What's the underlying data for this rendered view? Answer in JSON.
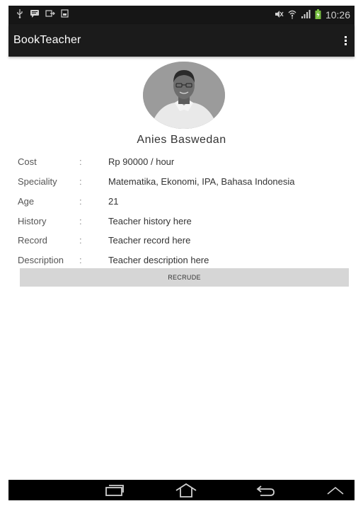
{
  "status_bar": {
    "time": "10:26",
    "icons_left": [
      "usb-icon",
      "message-icon",
      "transfer-icon",
      "gallery-icon"
    ],
    "icons_right": [
      "mute-icon",
      "wifi-icon",
      "signal-icon",
      "battery-icon"
    ]
  },
  "app_bar": {
    "title": "BookTeacher",
    "menu_icon": "overflow-menu-icon"
  },
  "teacher": {
    "name": "Anies Baswedan",
    "fields": [
      {
        "label": "Cost",
        "separator": ":",
        "value": "Rp 90000 / hour"
      },
      {
        "label": "Speciality",
        "separator": ":",
        "value": "Matematika, Ekonomi, IPA, Bahasa Indonesia"
      },
      {
        "label": "Age",
        "separator": ":",
        "value": "21"
      },
      {
        "label": "History",
        "separator": ":",
        "value": "Teacher history here"
      },
      {
        "label": "Record",
        "separator": ":",
        "value": "Teacher record here"
      },
      {
        "label": "Description",
        "separator": ":",
        "value": "Teacher description here"
      }
    ]
  },
  "action": {
    "button_label": "RECRUDE"
  },
  "nav_bar": {
    "buttons": [
      "recent-apps-icon",
      "home-icon",
      "back-icon",
      "menu-up-icon"
    ]
  },
  "colors": {
    "status_bar": "#161616",
    "app_bar": "#1b1b1b",
    "button_bg": "#d6d6d6",
    "nav_bar": "#000000",
    "text": "#444444"
  }
}
